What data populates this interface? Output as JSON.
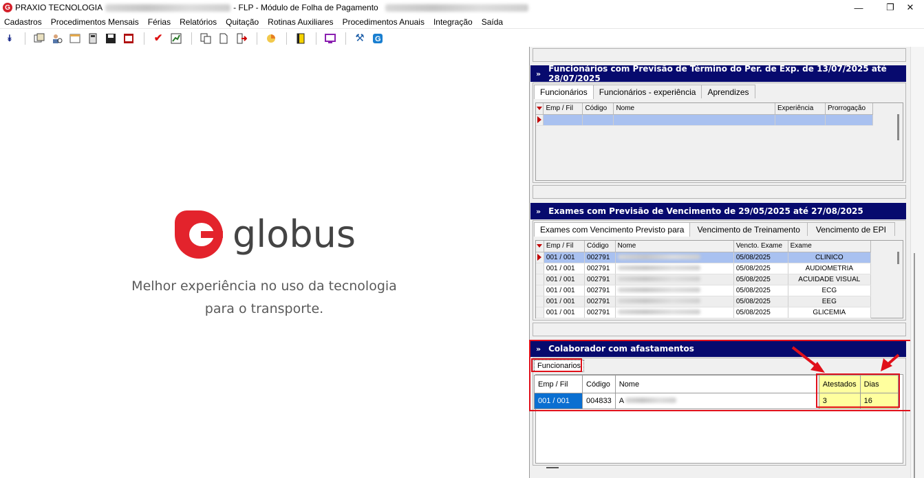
{
  "window": {
    "title_prefix": "PRAXIO TECNOLOGIA",
    "title_suffix": "- FLP - Módulo de Folha de Pagamento",
    "logo_letter": "G",
    "minimize_glyph": "—",
    "maximize_glyph": "❐",
    "close_glyph": "✕"
  },
  "menu": {
    "items": [
      "Cadastros",
      "Procedimentos Mensais",
      "Férias",
      "Relatórios",
      "Quitação",
      "Rotinas Auxiliares",
      "Procedimentos Anuais",
      "Integração",
      "Saída"
    ]
  },
  "toolbar": {
    "icons": [
      "collapse-icon",
      "open-records-icon",
      "person-search-icon",
      "window-icon",
      "calculator-icon",
      "save-icon",
      "report-icon",
      "check-icon",
      "chart-icon",
      "copy-icon",
      "new-document-icon",
      "export-icon",
      "pie-chart-icon",
      "book-icon",
      "monitor-icon",
      "tools-icon",
      "globus-icon"
    ]
  },
  "splash": {
    "brand_name": "globus",
    "tagline_line1": "Melhor experiência no uso da tecnologia",
    "tagline_line2": "para o transporte.",
    "brand_color": "#e3232c"
  },
  "section_experiencia": {
    "header": "Funcionários com Previsão de Término do Per. de Exp. de 13/07/2025 até 28/07/2025",
    "tabs": [
      "Funcionários",
      "Funcionários - experiência",
      "Aprendizes"
    ],
    "columns": [
      "Emp / Fil",
      "Código",
      "Nome",
      "Experiência",
      "Prorrogação"
    ]
  },
  "section_exames": {
    "header": "Exames com Previsão de Vencimento de 29/05/2025 até 27/08/2025",
    "tabs": [
      "Exames com Vencimento Previsto para",
      "Vencimento de Treinamento",
      "Vencimento de EPI"
    ],
    "columns": [
      "Emp / Fil",
      "Código",
      "Nome",
      "Vencto. Exame",
      "Exame"
    ],
    "rows": [
      {
        "emp": "001 / 001",
        "codigo": "002791",
        "vencto": "05/08/2025",
        "exame": "CLINICO"
      },
      {
        "emp": "001 / 001",
        "codigo": "002791",
        "vencto": "05/08/2025",
        "exame": "AUDIOMETRIA"
      },
      {
        "emp": "001 / 001",
        "codigo": "002791",
        "vencto": "05/08/2025",
        "exame": "ACUIDADE VISUAL"
      },
      {
        "emp": "001 / 001",
        "codigo": "002791",
        "vencto": "05/08/2025",
        "exame": "ECG"
      },
      {
        "emp": "001 / 001",
        "codigo": "002791",
        "vencto": "05/08/2025",
        "exame": "EEG"
      },
      {
        "emp": "001 / 001",
        "codigo": "002791",
        "vencto": "05/08/2025",
        "exame": "GLICEMIA"
      }
    ]
  },
  "section_afastamentos": {
    "header": "Colaborador com afastamentos",
    "tab": "Funcionarios",
    "columns": [
      "Emp / Fil",
      "Código",
      "Nome",
      "Atestados",
      "Dias"
    ],
    "row": {
      "emp": "001 / 001",
      "codigo": "004833",
      "nome_initial": "A",
      "atestados": "3",
      "dias": "16"
    }
  },
  "colors": {
    "section_header": "#070a6e",
    "highlight_red": "#e0101a",
    "highlight_yellow": "#ffff9e",
    "selection_blue": "#0a6fd1",
    "row_selected": "#a9c1f0"
  }
}
